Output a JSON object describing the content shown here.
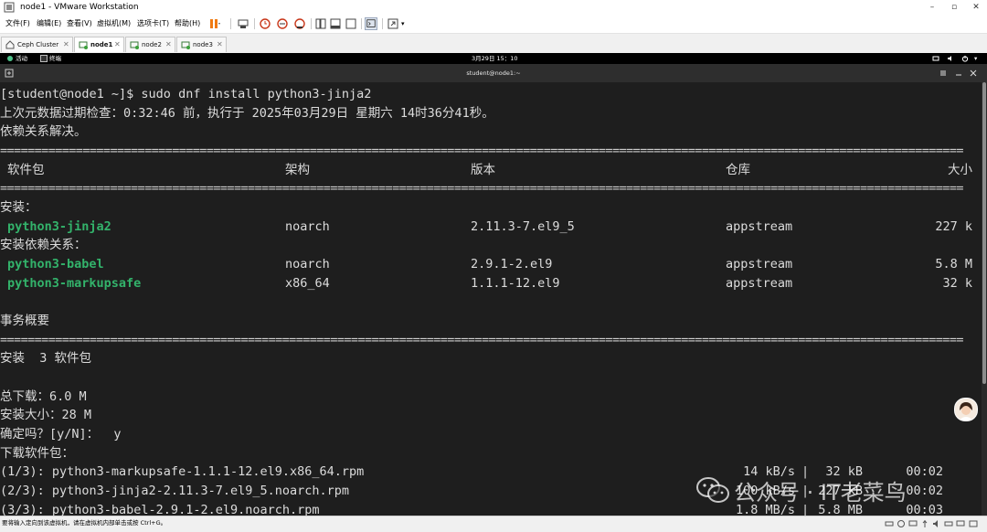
{
  "window": {
    "title": "node1 - VMware Workstation",
    "controls": [
      "–",
      "▫",
      "✕"
    ]
  },
  "menubar": {
    "items": [
      "文件(F)",
      "编辑(E)",
      "查看(V)",
      "虚拟机(M)",
      "选项卡(T)",
      "帮助(H)"
    ]
  },
  "tabs": [
    {
      "label": "Ceph Cluster",
      "active": false
    },
    {
      "label": "node1",
      "active": true
    },
    {
      "label": "node2",
      "active": false
    },
    {
      "label": "node3",
      "active": false
    }
  ],
  "guest_bar": {
    "activities": "活动",
    "terminal_app": "终端",
    "clock": "3月29日  15：10"
  },
  "terminal": {
    "title": "student@node1:~",
    "prompt_line": "[student@node1 ~]$ sudo dnf install python3-jinja2",
    "metadata_line": "上次元数据过期检查：0:32:46 前，执行于 2025年03月29日 星期六 14时36分41秒。",
    "resolved_line": "依赖关系解决。",
    "headers": {
      "package": "软件包",
      "arch": "架构",
      "version": "版本",
      "repo": "仓库",
      "size": "大小"
    },
    "install_label": "安装：",
    "install_rows": [
      {
        "name": "python3-jinja2",
        "arch": "noarch",
        "version": "2.11.3-7.el9_5",
        "repo": "appstream",
        "size": "227 k"
      }
    ],
    "deps_label": "安装依赖关系：",
    "dep_rows": [
      {
        "name": "python3-babel",
        "arch": "noarch",
        "version": "2.9.1-2.el9",
        "repo": "appstream",
        "size": "5.8 M"
      },
      {
        "name": "python3-markupsafe",
        "arch": "x86_64",
        "version": "1.1.1-12.el9",
        "repo": "appstream",
        "size": "32 k"
      }
    ],
    "summary_label": "事务概要",
    "install_count": "安装  3 软件包",
    "total_download": "总下载：6.0 M",
    "installed_size": "安装大小：28 M",
    "confirm": "确定吗？[y/N]：  y",
    "downloading": "下载软件包：",
    "downloads": [
      {
        "file": "(1/3): python3-markupsafe-1.1.1-12.el9.x86_64.rpm",
        "speed": "14 kB/s",
        "size": "32 kB",
        "time": "00:02"
      },
      {
        "file": "(2/3): python3-jinja2-2.11.3-7.el9_5.noarch.rpm",
        "speed": "100 kB/s",
        "size": "227 kB",
        "time": "00:02"
      },
      {
        "file": "(3/3): python3-babel-2.9.1-2.el9.noarch.rpm",
        "speed": "1.8 MB/s",
        "size": "5.8 MB",
        "time": "00:03"
      }
    ],
    "separator_char": "="
  },
  "watermark": {
    "text": "公众号 · IT老菜鸟"
  },
  "statusbar": {
    "text": "要将输入定向到该虚拟机，请在虚拟机内部单击或按 Ctrl+G。"
  },
  "colors": {
    "package_green": "#33b36b",
    "terminal_bg": "#1e1e1e",
    "pause_orange": "#f07a12"
  }
}
